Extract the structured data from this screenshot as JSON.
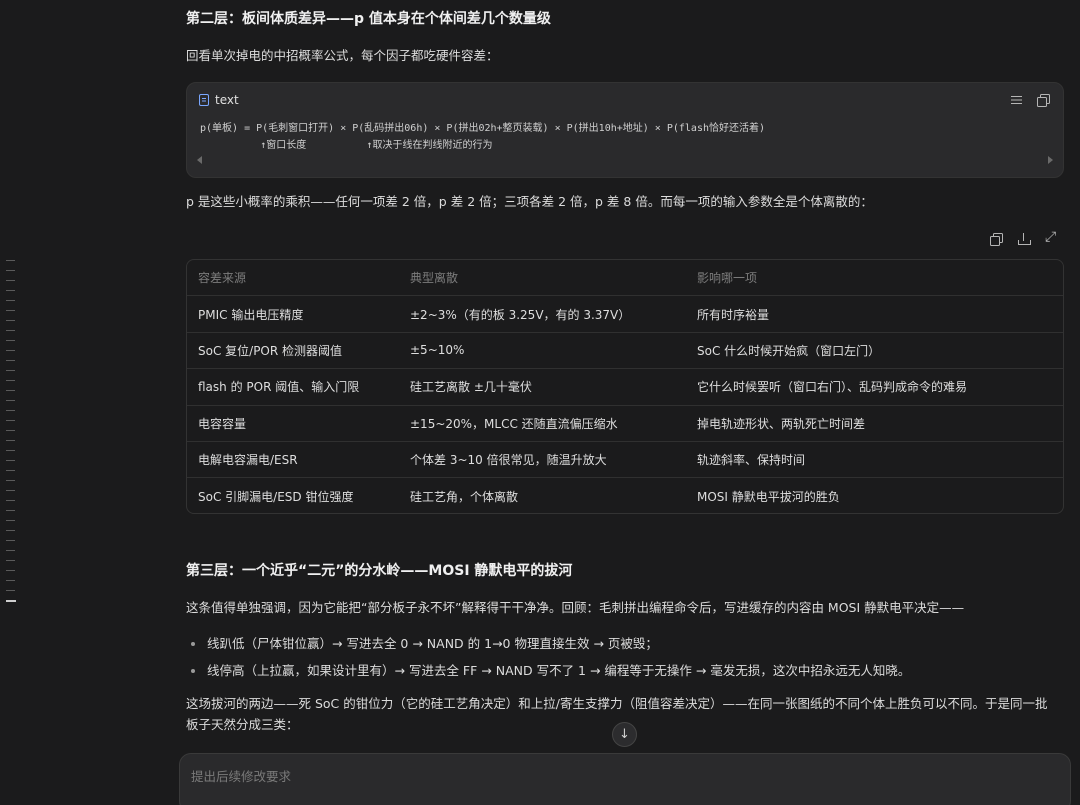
{
  "section2": {
    "heading": "第二层：板间体质差异——p 值本身在个体间差几个数量级",
    "intro": "回看单次掉电的中招概率公式，每个因子都吃硬件容差："
  },
  "codeblock": {
    "lang": "text",
    "lines": [
      "p(单板) = P(毛刺窗口打开) × P(乱码拼出06h) × P(拼出02h+整页装载) × P(拼出10h+地址) × P(flash恰好还活着)",
      "          ↑窗口长度          ↑取决于线在判线附近的行为"
    ],
    "icons": [
      "file-icon",
      "wrap-icon",
      "copy-icon"
    ]
  },
  "section2_after": "p 是这些小概率的乘积——任何一项差 2 倍，p 差 2 倍；三项各差 2 倍，p 差 8 倍。而每一项的输入参数全是个体离散的：",
  "table_tools": [
    "copy-icon",
    "download-icon",
    "expand-icon"
  ],
  "table": {
    "headers": [
      "容差来源",
      "典型离散",
      "影响哪一项"
    ],
    "rows": [
      [
        "PMIC 输出电压精度",
        "±2~3%（有的板 3.25V，有的 3.37V）",
        "所有时序裕量"
      ],
      [
        "SoC 复位/POR 检测器阈值",
        "±5~10%",
        "SoC 什么时候开始疯（窗口左门）"
      ],
      [
        "flash 的 POR 阈值、输入门限",
        "硅工艺离散 ±几十毫伏",
        "它什么时候罢听（窗口右门）、乱码判成命令的难易"
      ],
      [
        "电容容量",
        "±15~20%，MLCC 还随直流偏压缩水",
        "掉电轨迹形状、两轨死亡时间差"
      ],
      [
        "电解电容漏电/ESR",
        "个体差 3~10 倍很常见，随温升放大",
        "轨迹斜率、保持时间"
      ],
      [
        "SoC 引脚漏电/ESD 钳位强度",
        "硅工艺角，个体离散",
        "MOSI 静默电平拔河的胜负"
      ]
    ]
  },
  "section3": {
    "heading": "第三层：一个近乎“二元”的分水岭——MOSI 静默电平的拔河",
    "intro": "这条值得单独强调，因为它能把“部分板子永不坏”解释得干干净净。回顾：毛刺拼出编程命令后，写进缓存的内容由 MOSI 静默电平决定——",
    "bullets": [
      "线趴低（尸体钳位赢）→ 写进去全 0 → NAND 的 1→0 物理直接生效 → 页被毁；",
      "线停高（上拉赢，如果设计里有）→ 写进去全 FF → NAND 写不了 1 → 编程等于无操作 → 毫发无损，这次中招永远无人知晓。"
    ],
    "closing_line1": "这场拔河的两边——死 SoC 的钳位力（它的硅工艺角决定）和上拉/寄生支撑力（阻值容差决定）——在同一张图纸的不同个体上胜负可以不同。于是同一批",
    "closing_line2": "板子天然分成三类："
  },
  "composer": {
    "placeholder": "提出后续修改要求"
  },
  "scroll_down_icon": "↓"
}
